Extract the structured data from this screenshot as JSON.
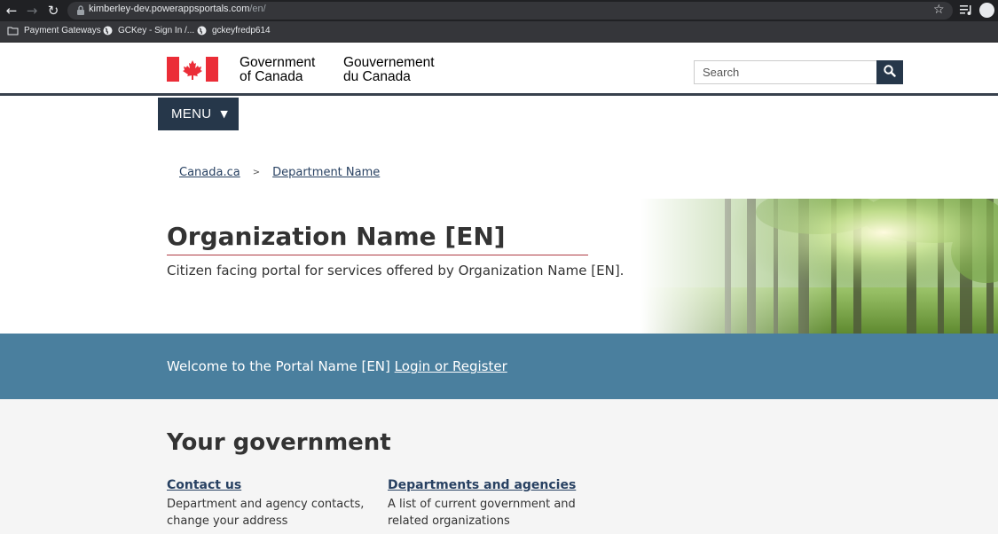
{
  "browser": {
    "url_domain": "kimberley-dev.powerappsportals.com",
    "url_path": "/en/",
    "bookmarks": [
      "Payment Gateways",
      "GCKey - Sign In /...",
      "gckeyfredp614"
    ]
  },
  "header": {
    "gov_en_line1": "Government",
    "gov_en_line2": "of Canada",
    "gov_fr_line1": "Gouvernement",
    "gov_fr_line2": "du Canada",
    "search_placeholder": "Search"
  },
  "menu": {
    "label": "MENU"
  },
  "breadcrumb": {
    "items": [
      "Canada.ca",
      "Department Name"
    ],
    "separator": ">"
  },
  "hero": {
    "title": "Organization Name [EN]",
    "description": "Citizen facing portal for services offered by Organization Name [EN]."
  },
  "welcome": {
    "text": "Welcome to the Portal Name [EN]",
    "link": "Login or Register"
  },
  "government": {
    "title": "Your government",
    "cards": [
      {
        "link": "Contact us",
        "desc_line1": "Department and agency contacts,",
        "desc_line2": "change your address"
      },
      {
        "link": "Departments and agencies",
        "desc_line1": "A list of current government and",
        "desc_line2": "related organizations"
      }
    ]
  },
  "colors": {
    "chrome_dark": "#202124",
    "header_rule": "#38414d",
    "menu_bg": "#26374a",
    "welcome_bg": "#4a7f9e",
    "link": "#284162",
    "title_rule": "#af3c43",
    "flag_red": "#eb2d37"
  },
  "icons": [
    "back-icon",
    "forward-icon",
    "reload-icon",
    "lock-icon",
    "star-icon",
    "playlist-icon",
    "profile-icon",
    "folder-icon",
    "globe-icon",
    "search-icon",
    "chevron-down-icon",
    "maple-leaf-flag"
  ]
}
